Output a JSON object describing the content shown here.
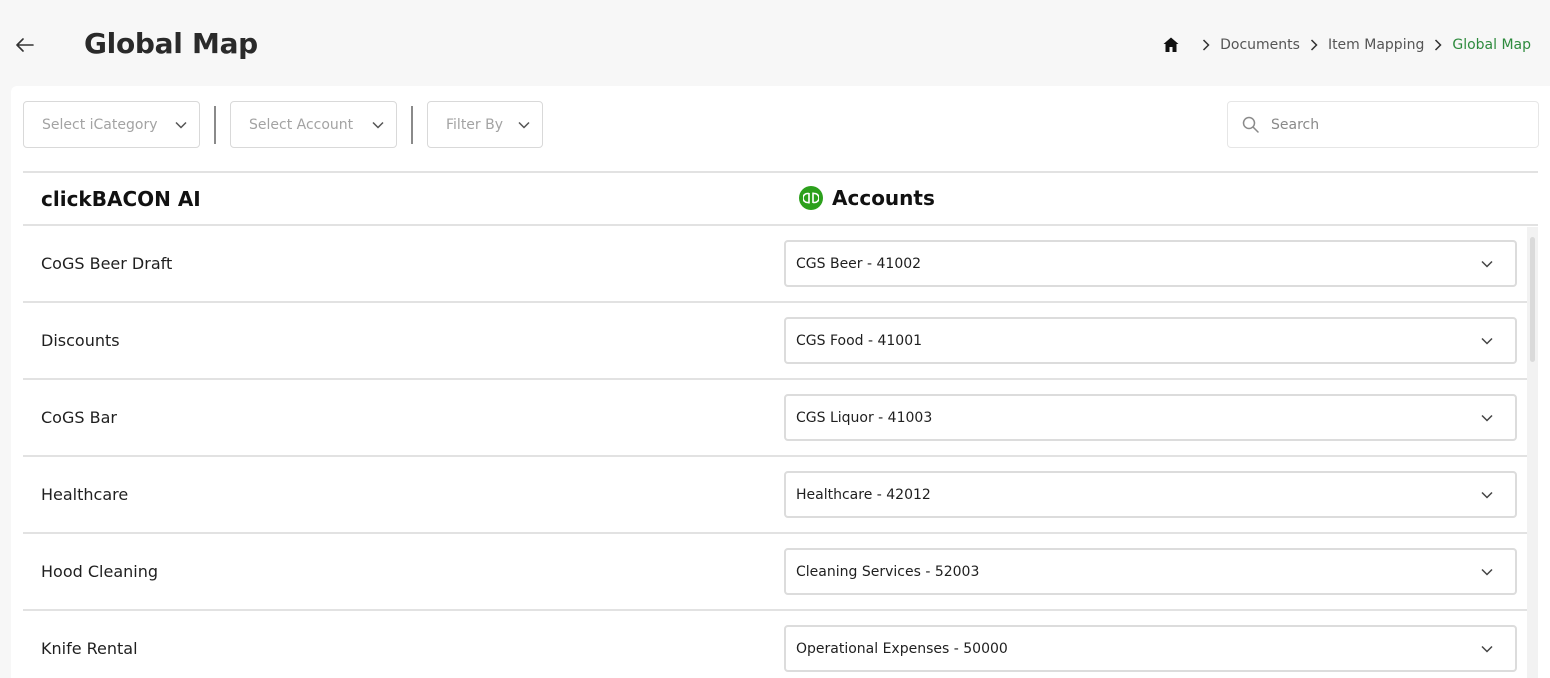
{
  "header": {
    "title": "Global Map",
    "breadcrumb": [
      "Documents",
      "Item Mapping",
      "Global Map"
    ]
  },
  "filters": {
    "category_placeholder": "Select iCategory",
    "account_placeholder": "Select Account",
    "filter_by": "Filter By"
  },
  "search": {
    "placeholder": "Search"
  },
  "table": {
    "left_header": "clickBACON AI",
    "right_header": "Accounts",
    "rows": [
      {
        "item": "CoGS Beer Draft",
        "account": "CGS Beer - 41002"
      },
      {
        "item": "Discounts",
        "account": "CGS Food - 41001"
      },
      {
        "item": "CoGS Bar",
        "account": "CGS Liquor - 41003"
      },
      {
        "item": "Healthcare",
        "account": "Healthcare - 42012"
      },
      {
        "item": "Hood Cleaning",
        "account": "Cleaning Services - 52003"
      },
      {
        "item": "Knife Rental",
        "account": "Operational Expenses - 50000"
      }
    ]
  },
  "colors": {
    "accent_green": "#2e8b3e",
    "quickbooks_green": "#2ca01c"
  }
}
